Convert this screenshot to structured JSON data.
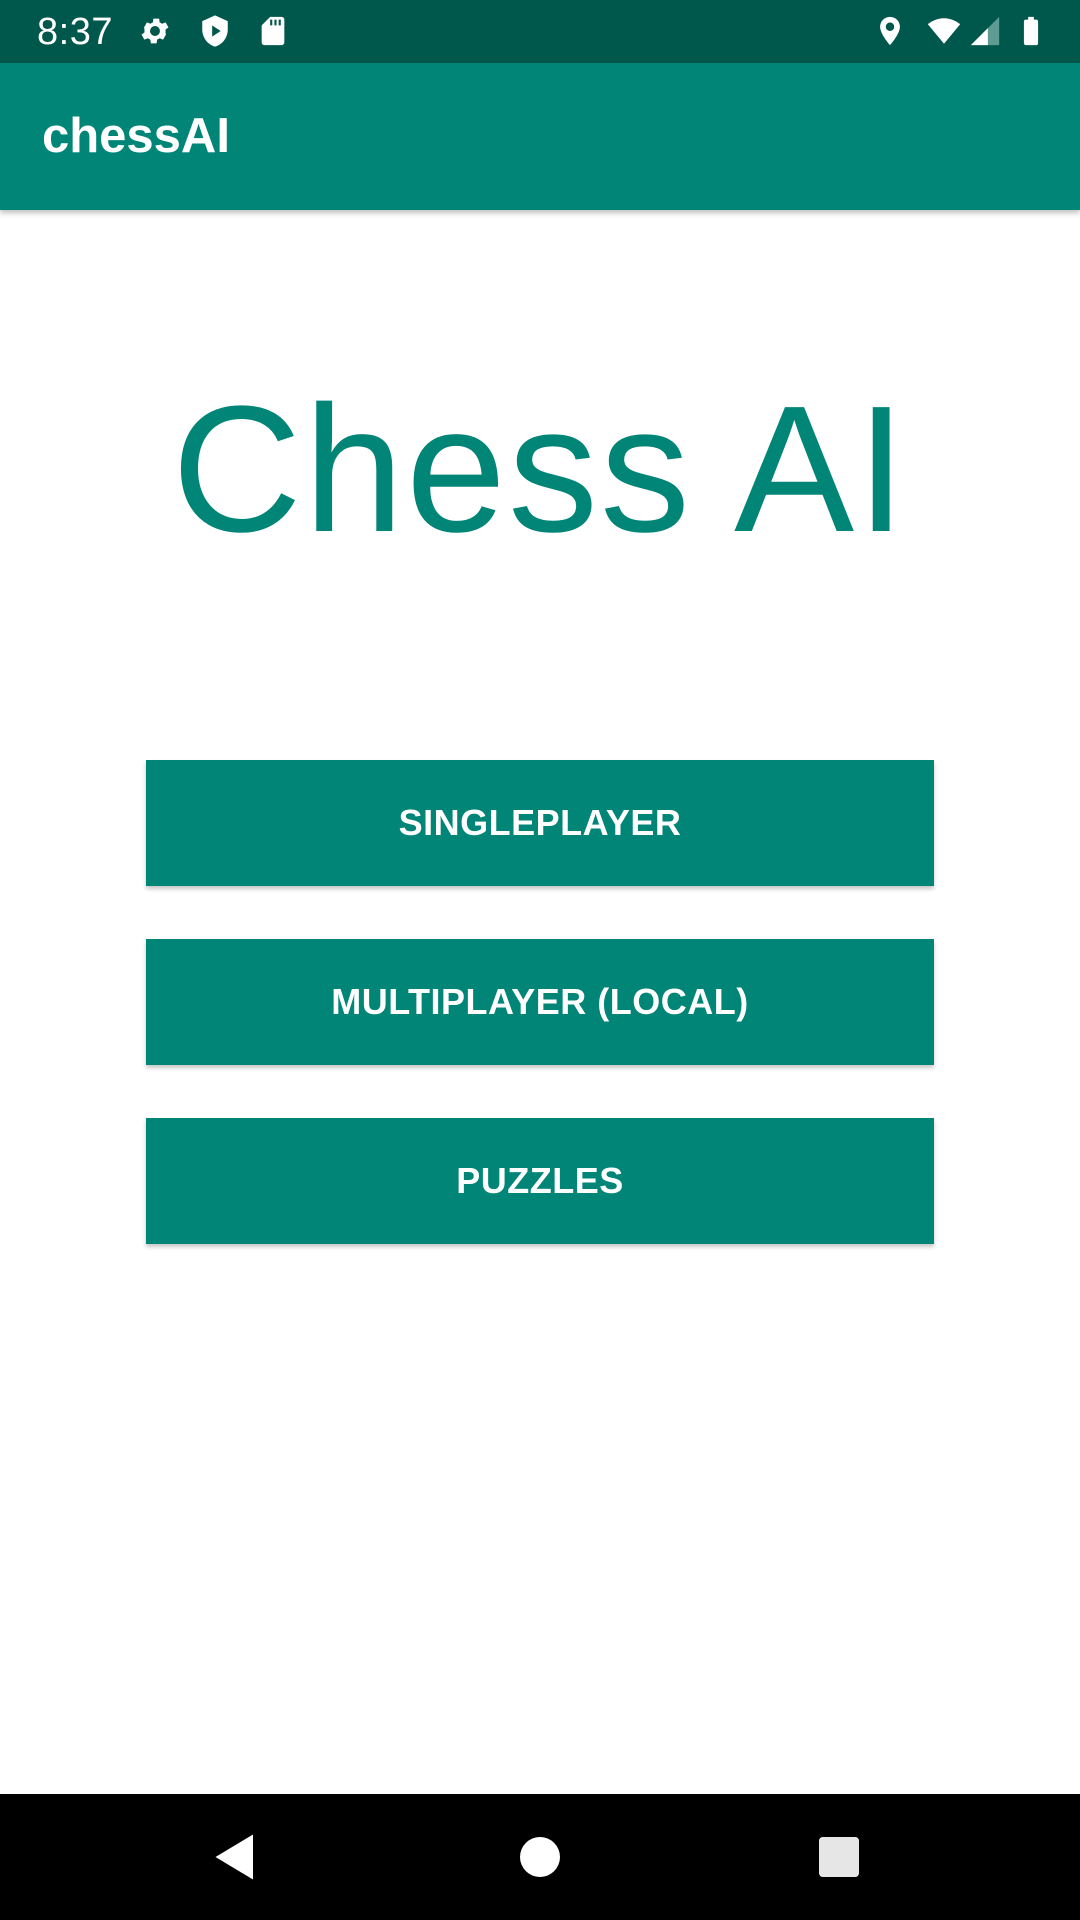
{
  "status_bar": {
    "time": "8:37",
    "left_icons": [
      "gear-icon",
      "play-shield-icon",
      "sd-card-icon"
    ],
    "right_icons": [
      "location-icon",
      "wifi-icon",
      "cell-signal-icon",
      "battery-icon"
    ],
    "background_color": "#00574b"
  },
  "app_bar": {
    "title": "chessAI",
    "background_color": "#008577"
  },
  "main": {
    "heading": "Chess AI",
    "heading_color": "#008577",
    "buttons": [
      {
        "label": "SINGLEPLAYER"
      },
      {
        "label": "MULTIPLAYER (LOCAL)"
      },
      {
        "label": "PUZZLES"
      }
    ],
    "button_color": "#008577"
  },
  "nav_bar": {
    "icons": [
      "back-icon",
      "home-icon",
      "recents-icon"
    ]
  }
}
